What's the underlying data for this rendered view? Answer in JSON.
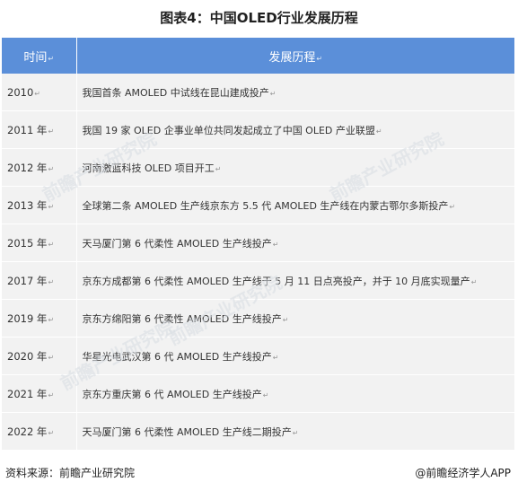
{
  "title": "图表4：中国OLED行业发展历程",
  "table": {
    "headers": [
      "时间",
      "发展历程"
    ],
    "rows": [
      {
        "year": "2010",
        "event": "我国首条 AMOLED 中试线在昆山建成投产"
      },
      {
        "year": "2011 年",
        "event": "我国 19 家 OLED 企事业单位共同发起成立了中国 OLED 产业联盟"
      },
      {
        "year": "2012 年",
        "event": "河南激蓝科技 OLED 项目开工"
      },
      {
        "year": "2013 年",
        "event": "全球第二条 AMOLED 生产线京东方 5.5 代 AMOLED 生产线在内蒙古鄂尔多斯投产"
      },
      {
        "year": "2015 年",
        "event": "天马厦门第 6 代柔性 AMOLED 生产线投产"
      },
      {
        "year": "2017 年",
        "event": "京东方成都第 6 代柔性 AMOLED 生产线于 5 月 11 日点亮投产，并于 10 月底实现量产"
      },
      {
        "year": "2019 年",
        "event": "京东方绵阳第 6 代柔性 AMOLED 生产线投产"
      },
      {
        "year": "2020 年",
        "event": "华星光电武汉第 6 代 AMOLED 生产线投产"
      },
      {
        "year": "2021 年",
        "event": "京东方重庆第 6 代 AMOLED 生产线投产"
      },
      {
        "year": "2022 年",
        "event": "天马厦门第 6 代柔性 AMOLED 生产线二期投产"
      }
    ]
  },
  "watermark": "前瞻产业研究院",
  "footer": {
    "source": "资料来源：前瞻产业研究院",
    "credit": "@前瞻经济学人APP"
  },
  "colors": {
    "header_bg": "#5b8fd9",
    "row_bg": "#f2f2f2"
  }
}
